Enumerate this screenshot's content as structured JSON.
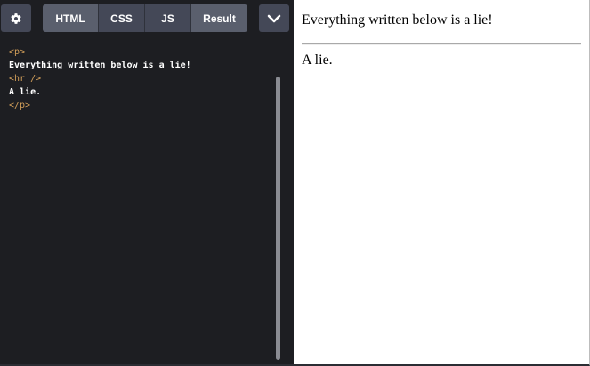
{
  "toolbar": {
    "settings_icon": "gear-icon",
    "tabs": [
      {
        "label": "HTML",
        "active": true
      },
      {
        "label": "CSS",
        "active": false
      },
      {
        "label": "JS",
        "active": false
      },
      {
        "label": "Result",
        "active": false
      }
    ],
    "menu_icon": "chevron-down-icon"
  },
  "editor": {
    "lines": [
      {
        "type": "tag",
        "text": "<p>"
      },
      {
        "type": "text",
        "text": "Everything written below is a lie!"
      },
      {
        "type": "tag",
        "text": "<hr />"
      },
      {
        "type": "text",
        "text": "A lie."
      },
      {
        "type": "tag",
        "text": "</p>"
      }
    ]
  },
  "result": {
    "text_before": "Everything written below is a lie!",
    "text_after": "A lie."
  },
  "colors": {
    "editor_bg": "#1d1e22",
    "tab_bg": "#444857",
    "tag_color": "#d4a05a",
    "text_color": "#ffffff"
  }
}
